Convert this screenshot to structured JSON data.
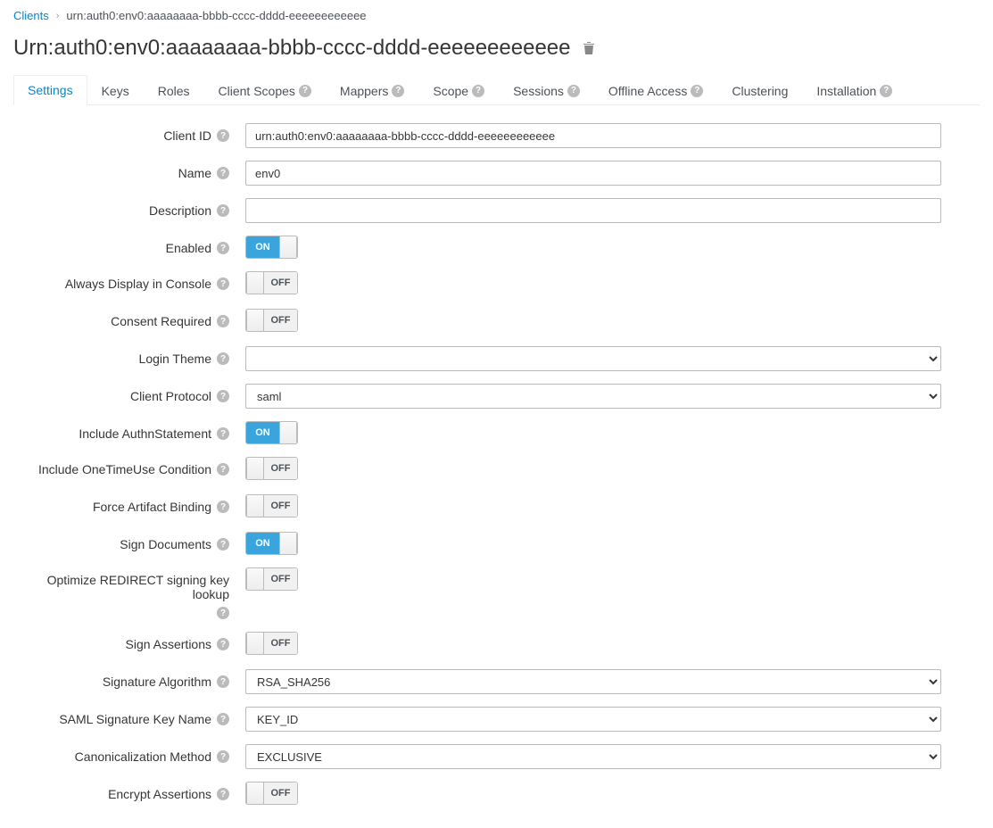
{
  "breadcrumb": {
    "root": "Clients",
    "current": "urn:auth0:env0:aaaaaaaa-bbbb-cccc-dddd-eeeeeeeeeeee"
  },
  "page_title": "Urn:auth0:env0:aaaaaaaa-bbbb-cccc-dddd-eeeeeeeeeeee",
  "tabs": {
    "settings": "Settings",
    "keys": "Keys",
    "roles": "Roles",
    "client_scopes": "Client Scopes",
    "mappers": "Mappers",
    "scope": "Scope",
    "sessions": "Sessions",
    "offline_access": "Offline Access",
    "clustering": "Clustering",
    "installation": "Installation"
  },
  "toggle_labels": {
    "on": "ON",
    "off": "OFF"
  },
  "fields": {
    "client_id": {
      "label": "Client ID",
      "value": "urn:auth0:env0:aaaaaaaa-bbbb-cccc-dddd-eeeeeeeeeeee"
    },
    "name": {
      "label": "Name",
      "value": "env0"
    },
    "description": {
      "label": "Description",
      "value": ""
    },
    "enabled": {
      "label": "Enabled",
      "on": true
    },
    "always_display": {
      "label": "Always Display in Console",
      "on": false
    },
    "consent_required": {
      "label": "Consent Required",
      "on": false
    },
    "login_theme": {
      "label": "Login Theme",
      "value": ""
    },
    "client_protocol": {
      "label": "Client Protocol",
      "value": "saml"
    },
    "include_authn": {
      "label": "Include AuthnStatement",
      "on": true
    },
    "include_onetime": {
      "label": "Include OneTimeUse Condition",
      "on": false
    },
    "force_artifact": {
      "label": "Force Artifact Binding",
      "on": false
    },
    "sign_documents": {
      "label": "Sign Documents",
      "on": true
    },
    "optimize_redirect": {
      "label": "Optimize REDIRECT signing key lookup",
      "on": false
    },
    "sign_assertions": {
      "label": "Sign Assertions",
      "on": false
    },
    "signature_algorithm": {
      "label": "Signature Algorithm",
      "value": "RSA_SHA256"
    },
    "saml_sig_key_name": {
      "label": "SAML Signature Key Name",
      "value": "KEY_ID"
    },
    "canonicalization": {
      "label": "Canonicalization Method",
      "value": "EXCLUSIVE"
    },
    "encrypt_assertions": {
      "label": "Encrypt Assertions",
      "on": false
    }
  }
}
